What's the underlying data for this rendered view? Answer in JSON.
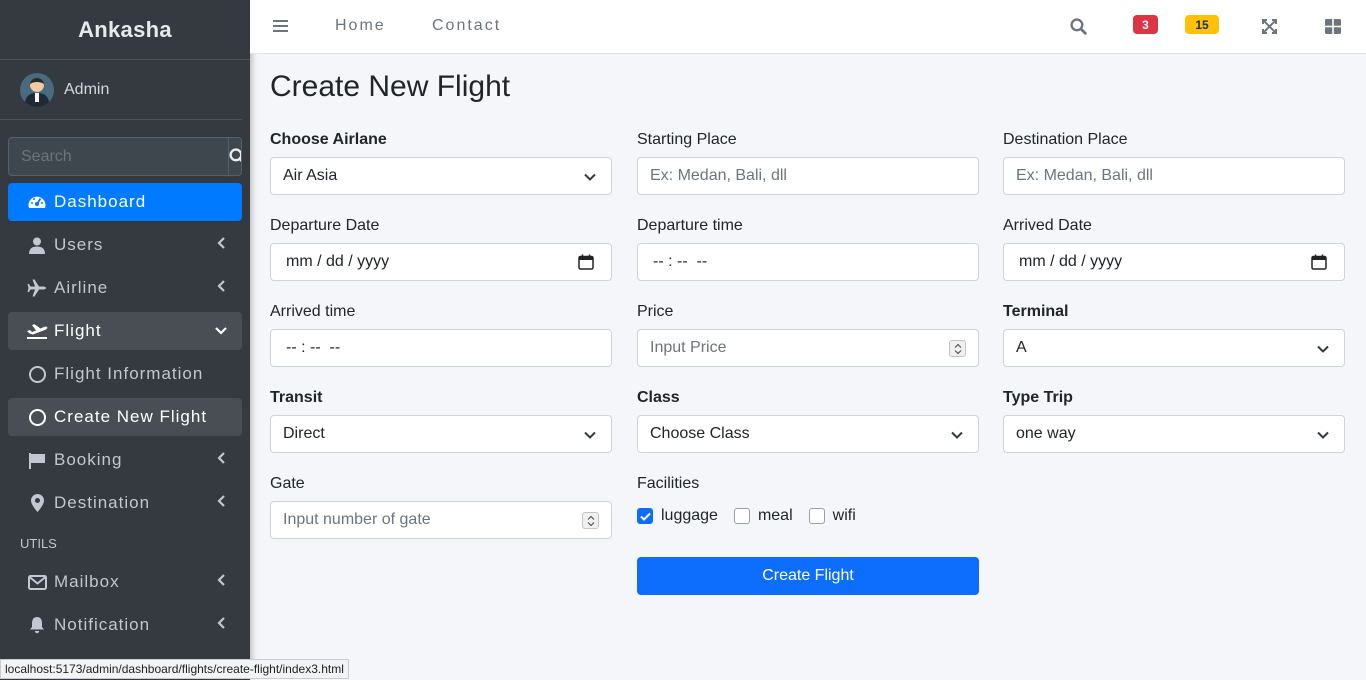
{
  "brand": "Ankasha",
  "user": {
    "name": "Admin"
  },
  "sidebar_search": {
    "placeholder": "Search"
  },
  "nav": {
    "dashboard": "Dashboard",
    "users": "Users",
    "airline": "Airline",
    "flight": "Flight",
    "flight_information": "Flight Information",
    "create_new_flight": "Create New Flight",
    "booking": "Booking",
    "destination": "Destination",
    "utils_header": "UTILS",
    "mailbox": "Mailbox",
    "notification": "Notification"
  },
  "topbar": {
    "home": "Home",
    "contact": "Contact",
    "messages_count": "3",
    "notifications_count": "15"
  },
  "colors": {
    "sidebar_bg": "#343a40",
    "active": "#007bff",
    "primary_button": "#0d6efd",
    "badge_danger": "#dc3545",
    "badge_warning": "#ffc107"
  },
  "form": {
    "title": "Create New Flight",
    "airline": {
      "label": "Choose Airlane",
      "value": "Air Asia"
    },
    "starting_place": {
      "label": "Starting Place",
      "placeholder": "Ex: Medan, Bali, dll"
    },
    "destination_place": {
      "label": "Destination Place",
      "placeholder": "Ex: Medan, Bali, dll"
    },
    "departure_date": {
      "label": "Departure Date",
      "value": "mm / dd / yyyy"
    },
    "departure_time": {
      "label": "Departure time",
      "value": "-- : --  --"
    },
    "arrived_date": {
      "label": "Arrived Date",
      "value": "mm / dd / yyyy"
    },
    "arrived_time": {
      "label": "Arrived time",
      "value": "-- : --  --"
    },
    "price": {
      "label": "Price",
      "placeholder": "Input Price"
    },
    "terminal": {
      "label": "Terminal",
      "value": "A"
    },
    "transit": {
      "label": "Transit",
      "value": "Direct"
    },
    "class": {
      "label": "Class",
      "value": "Choose Class"
    },
    "type_trip": {
      "label": "Type Trip",
      "value": "one way"
    },
    "gate": {
      "label": "Gate",
      "placeholder": "Input number of gate"
    },
    "facilities": {
      "label": "Facilities",
      "luggage": "luggage",
      "meal": "meal",
      "wifi": "wifi"
    },
    "submit": "Create Flight"
  },
  "status_url": "localhost:5173/admin/dashboard/flights/create-flight/index3.html"
}
